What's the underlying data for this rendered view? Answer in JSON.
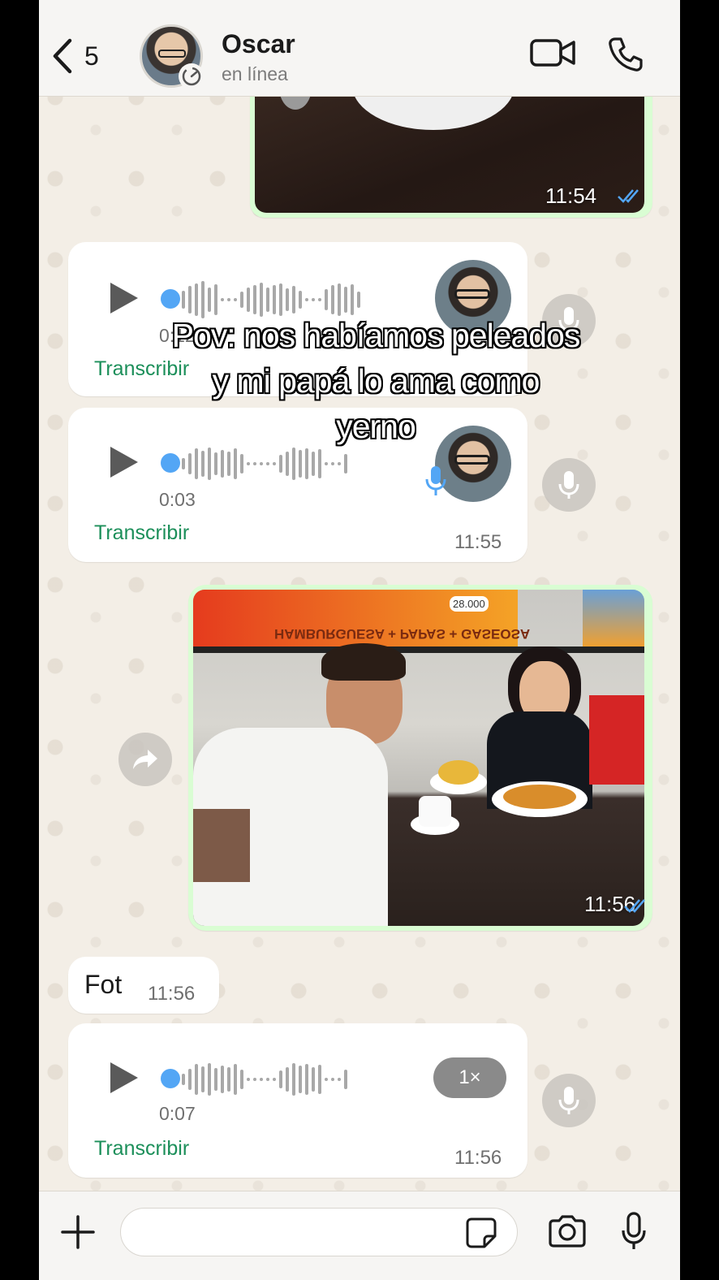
{
  "header": {
    "back_count": "5",
    "contact_name": "Oscar",
    "status": "en línea"
  },
  "messages": [
    {
      "type": "image",
      "direction": "outgoing",
      "time": "11:54",
      "read": true
    },
    {
      "type": "voice",
      "direction": "incoming",
      "duration": "0:12",
      "transcribe_label": "Transcribir",
      "time": ""
    },
    {
      "type": "voice",
      "direction": "incoming",
      "duration": "0:03",
      "transcribe_label": "Transcribir",
      "time": "11:55"
    },
    {
      "type": "image",
      "direction": "outgoing",
      "time": "11:56",
      "read": true,
      "photo_texts": {
        "sign": "HAMBURGUESA + PAPAS + GASEOSA",
        "price": "28.000"
      }
    },
    {
      "type": "text",
      "direction": "incoming",
      "text": "Fot",
      "time": "11:56"
    },
    {
      "type": "voice",
      "direction": "incoming",
      "duration": "0:07",
      "transcribe_label": "Transcribir",
      "time": "11:56",
      "speed": "1×"
    }
  ],
  "overlay_caption": "Pov: nos habíamos peleados y mi papá lo ama como yerno",
  "colors": {
    "outgoing_bubble": "#d9fdd3",
    "read_ticks": "#53a6f5",
    "transcribe": "#1c8f5a"
  },
  "icons": [
    "back-chevron-icon",
    "disappearing-timer-icon",
    "video-call-icon",
    "phone-icon",
    "play-icon",
    "microphone-icon",
    "forward-icon",
    "plus-icon",
    "sticker-icon",
    "camera-icon"
  ]
}
